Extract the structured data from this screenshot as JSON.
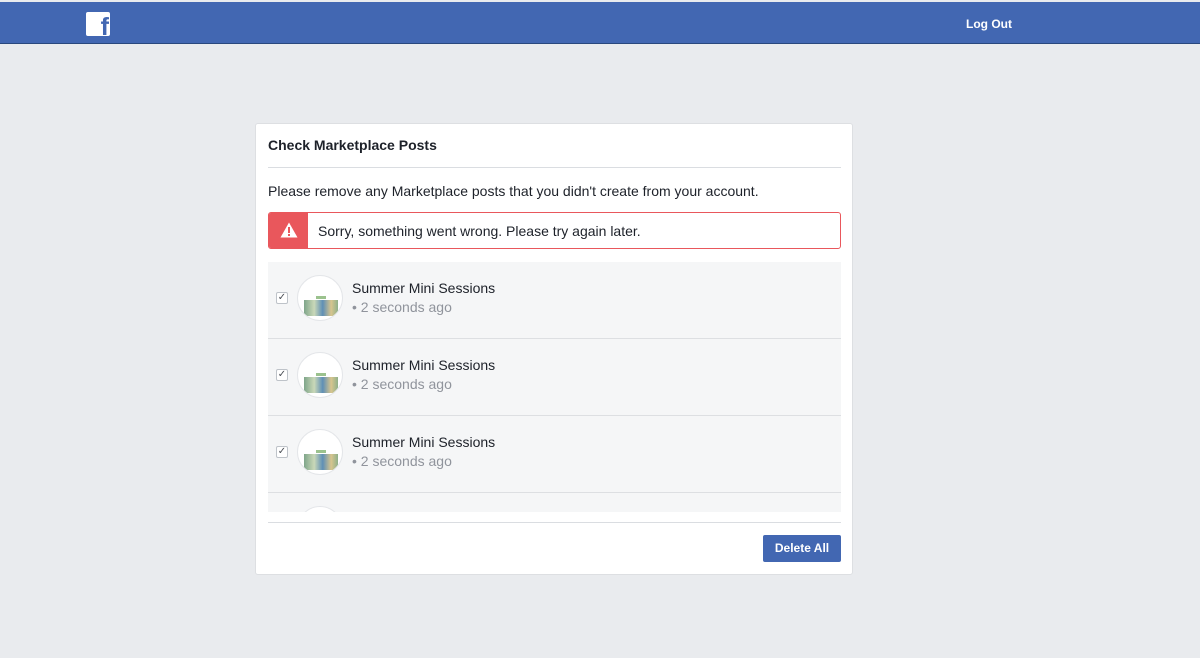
{
  "header": {
    "logo_letter": "f",
    "logout_label": "Log Out"
  },
  "dialog": {
    "title": "Check Marketplace Posts",
    "description": "Please remove any Marketplace posts that you didn't create from your account.",
    "error_message": "Sorry, something went wrong. Please try again later.",
    "posts": [
      {
        "title": "Summer Mini Sessions",
        "time": "• 2 seconds ago",
        "checked": true
      },
      {
        "title": "Summer Mini Sessions",
        "time": "• 2 seconds ago",
        "checked": true
      },
      {
        "title": "Summer Mini Sessions",
        "time": "• 2 seconds ago",
        "checked": true
      }
    ],
    "delete_all_label": "Delete All"
  },
  "colors": {
    "brand": "#4267b2",
    "error": "#e9575c",
    "background": "#e9ebee"
  }
}
